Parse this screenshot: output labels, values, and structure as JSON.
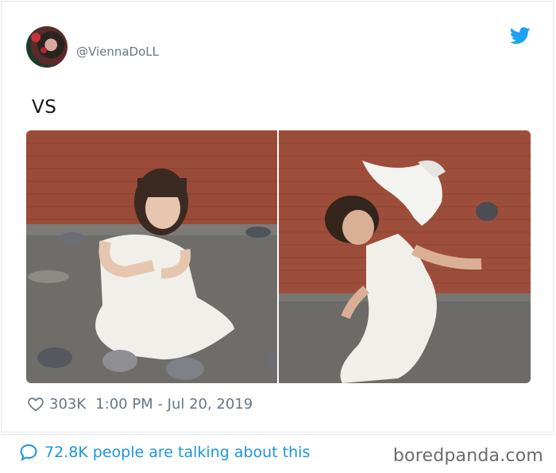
{
  "tweet": {
    "handle": "@ViennaDoLL",
    "text": "VS",
    "likes": "303K",
    "timestamp": "1:00 PM - Jul 20, 2019",
    "talking": "72.8K people are talking about this"
  },
  "icons": {
    "platform": "twitter-bird-icon",
    "like": "heart-icon",
    "reply": "speech-bubble-icon"
  },
  "watermark": "boredpanda.com",
  "colors": {
    "accent": "#1da1f2",
    "link": "#1b95e0",
    "muted": "#657786",
    "border": "#e1e8ed"
  }
}
